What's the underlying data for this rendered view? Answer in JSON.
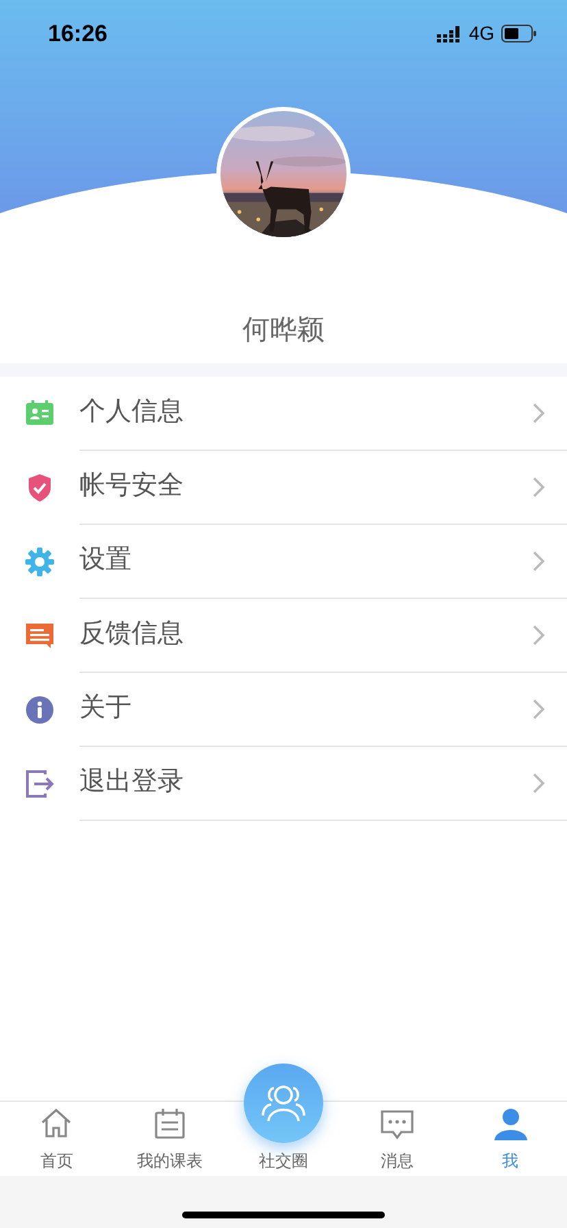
{
  "status_bar": {
    "time": "16:26",
    "network": "4G"
  },
  "profile": {
    "name": "何晔颖"
  },
  "menu": [
    {
      "kind": "profile",
      "label": "个人信息"
    },
    {
      "kind": "security",
      "label": "帐号安全"
    },
    {
      "kind": "settings",
      "label": "设置"
    },
    {
      "kind": "feedback",
      "label": "反馈信息"
    },
    {
      "kind": "about",
      "label": "关于"
    },
    {
      "kind": "logout",
      "label": "退出登录"
    }
  ],
  "tab_bar": [
    {
      "kind": "home",
      "label": "首页",
      "selected": false
    },
    {
      "kind": "schedule",
      "label": "我的课表",
      "selected": false
    },
    {
      "kind": "social",
      "label": "社交圈",
      "selected": false
    },
    {
      "kind": "messages",
      "label": "消息",
      "selected": false
    },
    {
      "kind": "me",
      "label": "我",
      "selected": true
    }
  ]
}
